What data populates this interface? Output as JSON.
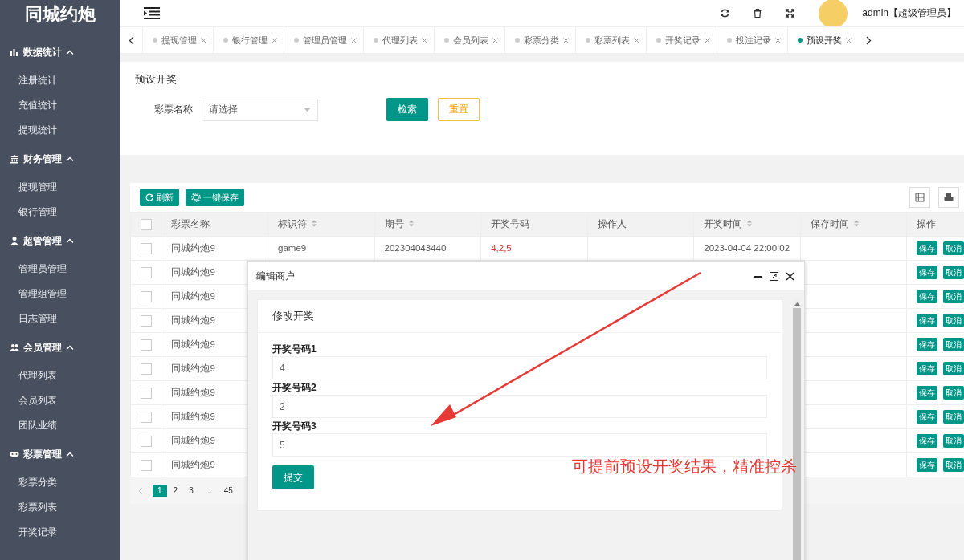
{
  "sidebar": {
    "logo": "同城约炮",
    "groups": [
      {
        "label": "数据统计",
        "kind": "chart",
        "expanded": true,
        "items": [
          "注册统计",
          "充值统计",
          "提现统计"
        ]
      },
      {
        "label": "财务管理",
        "kind": "bank",
        "expanded": true,
        "items": [
          "提现管理",
          "银行管理"
        ]
      },
      {
        "label": "超管管理",
        "kind": "user",
        "expanded": true,
        "items": [
          "管理员管理",
          "管理组管理",
          "日志管理"
        ]
      },
      {
        "label": "会员管理",
        "kind": "users",
        "expanded": true,
        "items": [
          "代理列表",
          "会员列表",
          "团队业绩"
        ]
      },
      {
        "label": "彩票管理",
        "kind": "game",
        "expanded": true,
        "items": [
          "彩票分类",
          "彩票列表",
          "开奖记录"
        ]
      }
    ]
  },
  "header": {
    "user": "admin【超级管理员】"
  },
  "tabs": [
    {
      "label": "提现管理",
      "selected": false
    },
    {
      "label": "银行管理",
      "selected": false
    },
    {
      "label": "管理员管理",
      "selected": false
    },
    {
      "label": "代理列表",
      "selected": false
    },
    {
      "label": "会员列表",
      "selected": false
    },
    {
      "label": "彩票分类",
      "selected": false
    },
    {
      "label": "彩票列表",
      "selected": false
    },
    {
      "label": "开奖记录",
      "selected": false
    },
    {
      "label": "投注记录",
      "selected": false
    },
    {
      "label": "预设开奖",
      "selected": true
    }
  ],
  "page_title": "预设开奖",
  "filter": {
    "label": "彩票名称",
    "placeholder": "请选择",
    "search_button": "检索",
    "reset_button": "重置"
  },
  "table": {
    "toolbar": [
      "刷新",
      "一键保存"
    ],
    "all_checked": false,
    "columns": [
      "彩票名称",
      "标识符",
      "期号",
      "开奖号码",
      "操作人",
      "开奖时间",
      "保存时间",
      "操作"
    ],
    "rows": [
      {
        "checked": false,
        "name": "同城约炮9",
        "code": "game9",
        "issue": "202304043440",
        "numbers": "4,2,5",
        "time": "2023-04-04 22:00:02",
        "actions": [
          "保存",
          "取消"
        ]
      },
      {
        "checked": false,
        "name": "同城约炮9",
        "actions": [
          "保存",
          "取消"
        ]
      },
      {
        "checked": false,
        "name": "同城约炮9",
        "actions": [
          "保存",
          "取消"
        ]
      },
      {
        "checked": false,
        "name": "同城约炮9",
        "actions": [
          "保存",
          "取消"
        ]
      },
      {
        "checked": false,
        "name": "同城约炮9",
        "actions": [
          "保存",
          "取消"
        ]
      },
      {
        "checked": false,
        "name": "同城约炮9",
        "actions": [
          "保存",
          "取消"
        ]
      },
      {
        "checked": false,
        "name": "同城约炮9",
        "actions": [
          "保存",
          "取消"
        ]
      },
      {
        "checked": false,
        "name": "同城约炮9",
        "actions": [
          "保存",
          "取消"
        ]
      },
      {
        "checked": false,
        "name": "同城约炮9",
        "actions": [
          "保存",
          "取消"
        ]
      },
      {
        "checked": false,
        "name": "同城约炮9",
        "actions": [
          "保存",
          "取消"
        ]
      }
    ],
    "pages": [
      {
        "label": "1",
        "selected": true
      },
      {
        "label": "2",
        "selected": false
      },
      {
        "label": "3",
        "selected": false
      },
      {
        "label": "…",
        "selected": false
      },
      {
        "label": "45",
        "selected": false
      }
    ]
  },
  "modal": {
    "title": "编辑商户",
    "heading": "修改开奖",
    "fields": [
      {
        "label": "开奖号码1",
        "value": "4"
      },
      {
        "label": "开奖号码2",
        "value": "2"
      },
      {
        "label": "开奖号码3",
        "value": "5"
      }
    ],
    "submit": "提交"
  },
  "annotation": {
    "text": "可提前预设开奖结果，精准控杀"
  }
}
